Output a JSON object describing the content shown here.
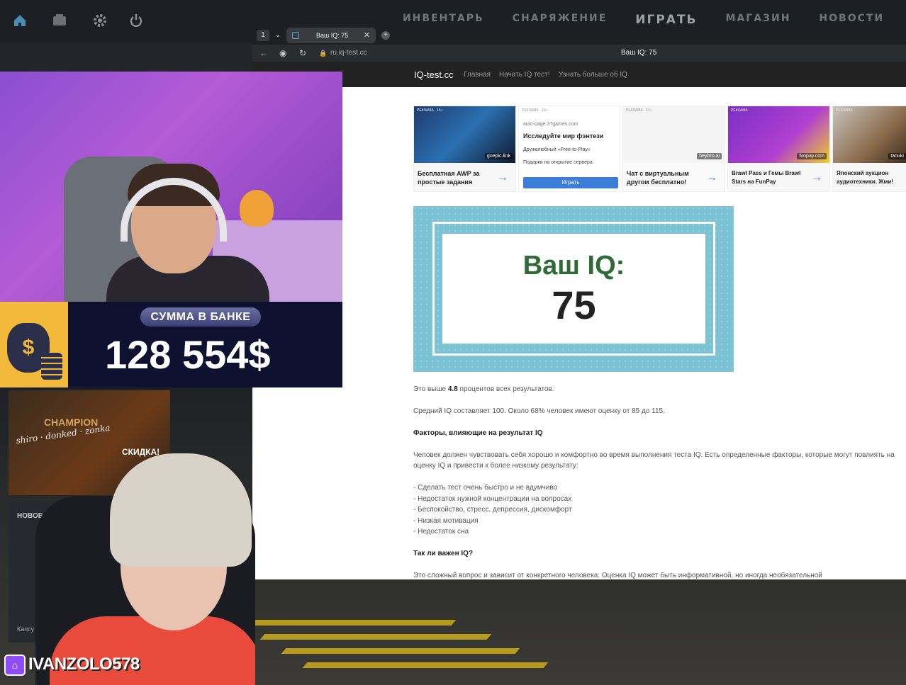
{
  "game": {
    "nav": [
      "ИНВЕНТАРЬ",
      "СНАРЯЖЕНИЕ",
      "ИГРАТЬ",
      "МАГАЗИН",
      "НОВОСТИ"
    ]
  },
  "browser": {
    "tab_title": "Ваш IQ: 75",
    "url": "ru.iq-test.cc",
    "page_title": "Ваш IQ: 75",
    "site_brand": "IQ-test.cc",
    "site_nav": [
      "Главная",
      "Начать IQ тест!",
      "Узнать больше об IQ"
    ]
  },
  "ads": [
    {
      "caption": "Бесплатная AWP за простые задания",
      "source": "goepic.link",
      "badge": "РЕКЛАМА · 16+"
    },
    {
      "domain": "auto-page.37games.com",
      "title": "Исследуйте мир фэнтези",
      "line1": "Дружелюбный «Free-to-Play»",
      "line2": "Подарки на открытие сервера",
      "button": "Играть",
      "badge": "РЕКЛАМА · 16+"
    },
    {
      "caption": "Чат с виртуальным другом бесплатно!",
      "source": "heybro.ai",
      "badge": "РЕКЛАМА · 12+"
    },
    {
      "caption": "Brawl Pass и Гемы Brawl Stars на FunPay",
      "source": "funpay.com",
      "badge": "РЕКЛАМА"
    },
    {
      "caption": "Японский аукцион аудиотехники. Жми!",
      "source": "tanuki",
      "badge": "РЕКЛАМА"
    }
  ],
  "result": {
    "label": "Ваш IQ:",
    "value": "75"
  },
  "article": {
    "p1_pre": "Это выше",
    "p1_bold": "4.8",
    "p1_post": "процентов всех результатов.",
    "p2": "Средний IQ составляет 100. Около 68% человек имеют оценку от 85 до 115.",
    "h1": "Факторы, влияющие на результат IQ",
    "p3a": "Человек должен чувствовать себя хорошо и комфортно во время выполнения теста IQ. Есть определенные факторы, которые могут повлиять на",
    "p3b": "оценку IQ и привести к более низкому результату:",
    "list": [
      "- Сделать тест очень быстро и не вдумчиво",
      "- Недостаток нужной концентрации на вопросах",
      "- Беспокойство, стресс, депрессия, дискомфорт",
      "- Низкая мотивация",
      "- Недостаток сна"
    ],
    "h2": "Так ли важен IQ?",
    "p4": "Это сложный вопрос и зависит от конкретного человека. Оценка IQ может быть информативной, но иногда необязательной"
  },
  "bank": {
    "label": "СУММА В БАНКЕ",
    "amount": "128 554$"
  },
  "tiles": {
    "champion": "CHAMPION",
    "skidka": "СКИДКА!",
    "signature": "shiro · donked · zonka",
    "new_popular": "НОВОЕ И ПОПУЛЯРНОЕ",
    "kapsula": "Капсу"
  },
  "streamer": {
    "name": "IVANZOLO578"
  }
}
